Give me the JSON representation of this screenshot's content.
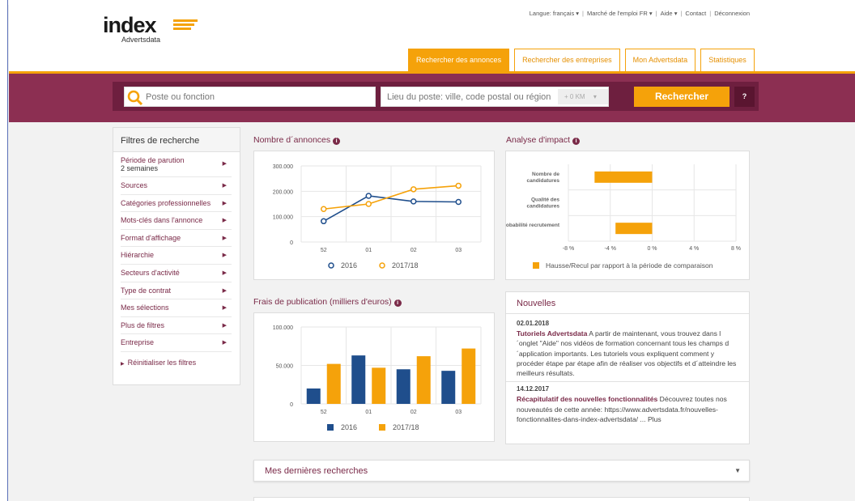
{
  "header": {
    "logo_text": "index",
    "logo_sub": "Advertsdata",
    "toplinks": [
      "Langue: français ▾",
      "Marché de l'emploi FR ▾",
      "Aide ▾",
      "Contact",
      "Déconnexion"
    ],
    "tabs": [
      "Rechercher des annonces",
      "Rechercher des entreprises",
      "Mon Advertsdata",
      "Statistiques"
    ]
  },
  "search": {
    "poste_placeholder": "Poste ou fonction",
    "lieu_placeholder": "Lieu du poste: ville, code postal ou région",
    "km": "+ 0 KM",
    "button": "Rechercher",
    "help": "?"
  },
  "filters": {
    "title": "Filtres de recherche",
    "periode_label": "Période de parution",
    "periode_value": "2 semaines",
    "items": [
      "Sources",
      "Catégories professionnelles",
      "Mots-clés dans l'annonce",
      "Format d'affichage",
      "Hiérarchie",
      "Secteurs d'activité",
      "Type de contrat",
      "Mes sélections",
      "Plus de filtres",
      "Entreprise"
    ],
    "reset": "Réinitialiser les filtres"
  },
  "sections": {
    "annonces_title": "Nombre d´annonces",
    "impact_title": "Analyse d'impact",
    "frais_title": "Frais de publication (milliers d'euros)"
  },
  "news": {
    "title": "Nouvelles",
    "items": [
      {
        "date": "02.01.2018",
        "lead": "Tutoriels Advertsdata",
        "text": " A partir de maintenant, vous trouvez dans l´onglet \"Aide\" nos vidéos de formation concernant tous les champs d´application importants. Les tutoriels vous expliquent comment y procéder étape par étape afin de réaliser vos objectifs et d´atteindre les meilleurs résultats."
      },
      {
        "date": "14.12.2017",
        "lead": "Récapitulatif des nouvelles fonctionnalités",
        "text": " Découvrez toutes nos nouveautés de cette année: https://www.advertsdata.fr/nouvelles-fonctionnalites-dans-index-advertsdata/ ... Plus"
      }
    ]
  },
  "accordion": {
    "label": "Mes dernières recherches"
  },
  "colors": {
    "series_2016": "#1f4e8c",
    "series_2017": "#f5a20a",
    "brand": "#8c2f52"
  },
  "chart_data": [
    {
      "type": "line",
      "categories": [
        "52",
        "01",
        "02",
        "03"
      ],
      "yticks": [
        "300.000",
        "200.000",
        "100.000",
        "0"
      ],
      "ylim": [
        0,
        300000
      ],
      "series": [
        {
          "name": "2016",
          "values": [
            82000,
            182000,
            160000,
            158000
          ]
        },
        {
          "name": "2017/18",
          "values": [
            130000,
            150000,
            208000,
            222000
          ]
        }
      ]
    },
    {
      "type": "bar",
      "orientation": "horizontal",
      "categories": [
        "Nombre de candidatures",
        "Qualité des candidatures",
        "Probabilité recrutement"
      ],
      "values": [
        -5.5,
        0,
        -3.5
      ],
      "xticks": [
        "-8 %",
        "-4 %",
        "0 %",
        "4 %",
        "8 %"
      ],
      "xlim": [
        -8,
        8
      ],
      "legend": "Hausse/Recul par rapport à la période de comparaison"
    },
    {
      "type": "bar",
      "categories": [
        "52",
        "01",
        "02",
        "03"
      ],
      "yticks": [
        "100.000",
        "50.000",
        "0"
      ],
      "ylim": [
        0,
        100000
      ],
      "series": [
        {
          "name": "2016",
          "values": [
            20000,
            63000,
            45000,
            43000
          ]
        },
        {
          "name": "2017/18",
          "values": [
            52000,
            47000,
            62000,
            72000
          ]
        }
      ]
    }
  ]
}
